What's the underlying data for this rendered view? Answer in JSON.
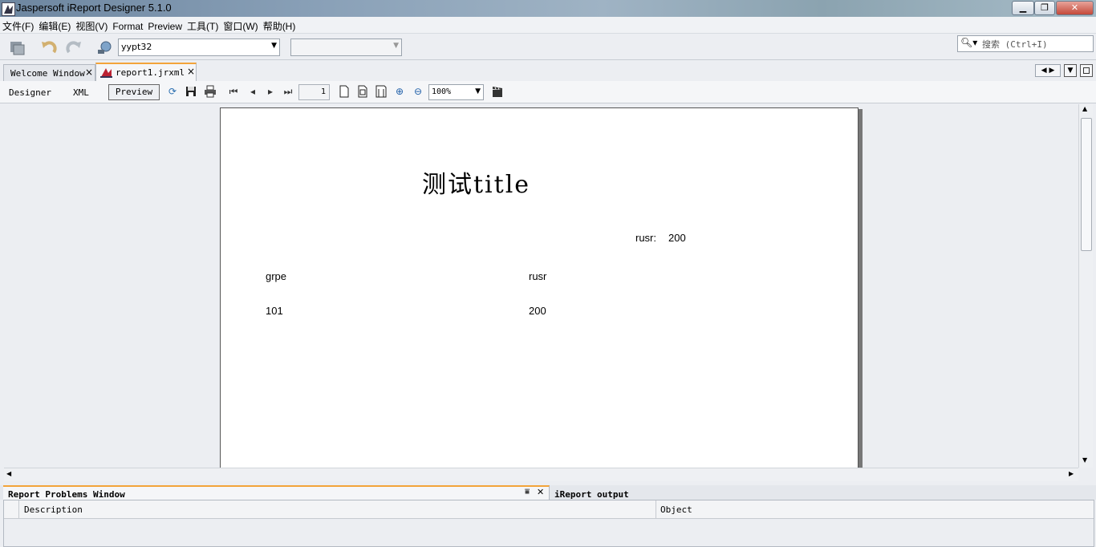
{
  "window": {
    "title": "Jaspersoft iReport Designer 5.1.0"
  },
  "menu": [
    "文件(F)",
    "编辑(E)",
    "视图(V)",
    "Format",
    "Preview",
    "工具(T)",
    "窗口(W)",
    "帮助(H)"
  ],
  "toolbar": {
    "datasource_value": "yypt32",
    "search_placeholder": "搜索 (Ctrl+I)"
  },
  "tabs": [
    {
      "label": "Welcome Window",
      "close": "×"
    },
    {
      "label": "report1.jrxml",
      "close": "×"
    }
  ],
  "view_modes": {
    "designer": "Designer",
    "xml": "XML",
    "preview": "Preview"
  },
  "preview_toolbar": {
    "page_number": "1",
    "zoom": "100%"
  },
  "report": {
    "title": "测试title",
    "summary_label": "rusr:",
    "summary_value": "200",
    "columns": [
      "grpe",
      "rusr"
    ],
    "rows": [
      [
        "101",
        "200"
      ]
    ]
  },
  "bottom": {
    "problems_tab": "Report Problems Window",
    "output_tab": "iReport output",
    "columns": [
      "Description",
      "Object"
    ]
  },
  "colors": {
    "accent": "#f3a43a",
    "paper": "#ffffff",
    "workspace": "#eceef2"
  },
  "icons": [
    "save-icon",
    "undo-icon",
    "redo-icon",
    "datasource-icon",
    "search-icon",
    "reload-icon",
    "printer-icon",
    "first-page-icon",
    "prev-page-icon",
    "next-page-icon",
    "last-page-icon",
    "zoom-in-icon",
    "zoom-out-icon",
    "clapper-icon"
  ]
}
